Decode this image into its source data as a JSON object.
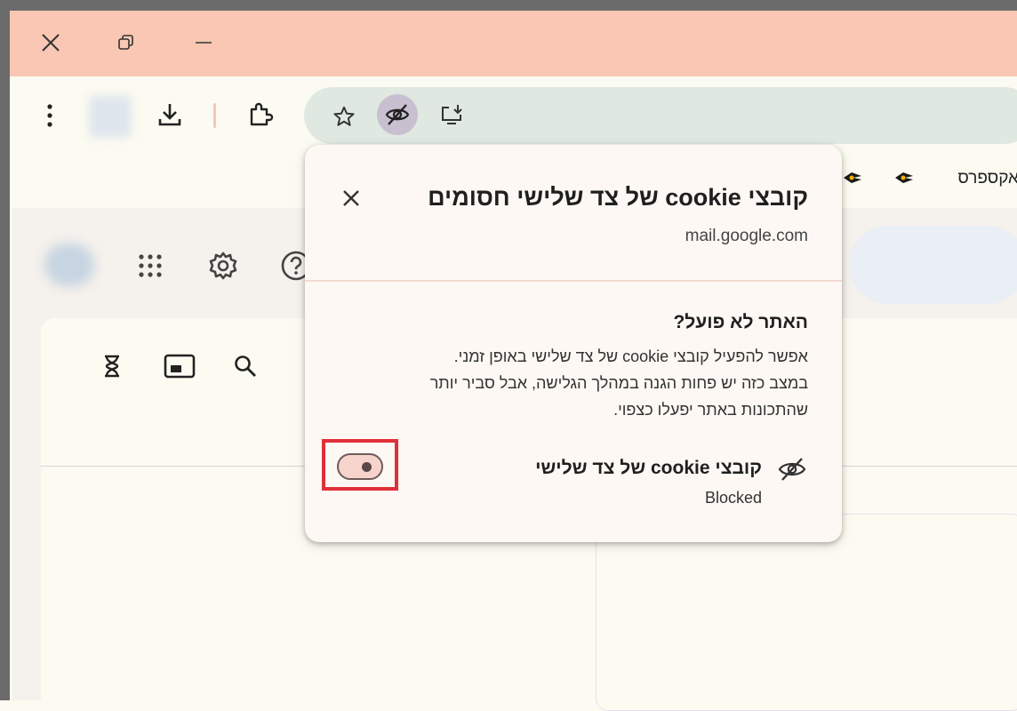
{
  "window_controls": {
    "close_icon": "close-icon",
    "restore_icon": "restore-icon",
    "minimize_icon": "minimize-icon"
  },
  "toolbar": {
    "menu_icon": "more-vertical-icon",
    "download_icon": "download-icon",
    "extensions_icon": "extension-icon"
  },
  "omnibox": {
    "bookmark_star_icon": "star-icon",
    "tracking_protection_icon": "eye-off-icon",
    "install_app_icon": "install-desktop-icon"
  },
  "bookmarks_bar": {
    "text": "אקספרס"
  },
  "gmail": {
    "icons": [
      "apps-grid-icon",
      "gear-icon",
      "help-icon",
      "hourglass-icon",
      "panel-icon",
      "search-icon"
    ]
  },
  "cookie_popup": {
    "title": "קובצי cookie של צד שלישי חסומים",
    "domain": "mail.google.com",
    "heading": "האתר לא פועל?",
    "description_lines": [
      "אפשר להפעיל קובצי cookie של צד שלישי באופן זמני.",
      "במצב כזה יש פחות הגנה במהלך הגלישה, אבל סביר יותר",
      "שהתכונות באתר יפעלו כצפוי."
    ],
    "toggle_label": "קובצי cookie של צד שלישי",
    "toggle_status": "Blocked",
    "toggle_on": false
  },
  "colors": {
    "titlebar": "#f9c7b3",
    "omnibox": "#dfe8e1",
    "highlight": "#e0303a",
    "popup_bg": "#fdf8f3"
  }
}
